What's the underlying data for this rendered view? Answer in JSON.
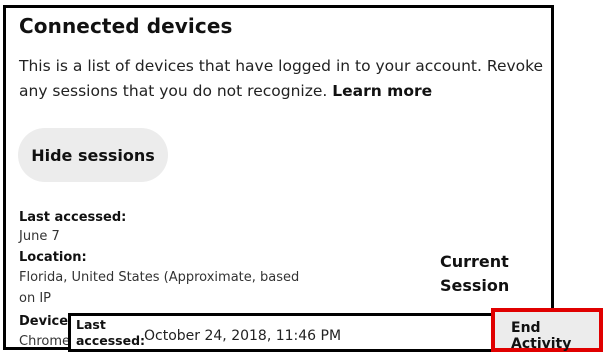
{
  "section": {
    "title": "Connected devices",
    "description": "This is a list of devices that have logged in to your account. Revoke any sessions that you do not recognize.",
    "learn_more": "Learn more",
    "hide_sessions_label": "Hide sessions"
  },
  "session": {
    "last_accessed_label": "Last accessed:",
    "last_accessed_value": "June 7",
    "location_label": "Location:",
    "location_value_line1": "Florida, United States (Approximate, based",
    "location_value_line2": "on IP",
    "device_label": "Device",
    "device_value": "Chrome",
    "current_line1": "Current",
    "current_line2": "Session"
  },
  "popup": {
    "last_label_line1": "Last",
    "last_label_line2": "accessed:",
    "last_value": "October 24, 2018, 11:46 PM",
    "end_activity_label": "End Activity"
  }
}
